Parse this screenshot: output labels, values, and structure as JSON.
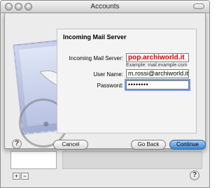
{
  "window": {
    "title": "Accounts"
  },
  "sheet": {
    "section_title": "Incoming Mail Server",
    "fields": {
      "server_label": "Incoming Mail Server:",
      "server_value": "pop.archiworld.it",
      "server_example": "Example: mail.example.com",
      "user_label": "User Name:",
      "user_value": "m.rossi@archiworld.it",
      "password_label": "Password:",
      "password_value": "••••••••"
    },
    "buttons": {
      "cancel": "Cancel",
      "go_back": "Go Back",
      "continue": "Continue"
    },
    "help": "?"
  },
  "background": {
    "plus": "+",
    "minus": "−",
    "help": "?"
  },
  "colors": {
    "server_text": "#d00000",
    "continue_button": "#3d86d6",
    "focus_ring": "#6f9fe0"
  },
  "icons": {
    "stamp": "mail-stamp-icon",
    "eagle": "eagle-icon",
    "apple": "apple-logo-icon"
  }
}
